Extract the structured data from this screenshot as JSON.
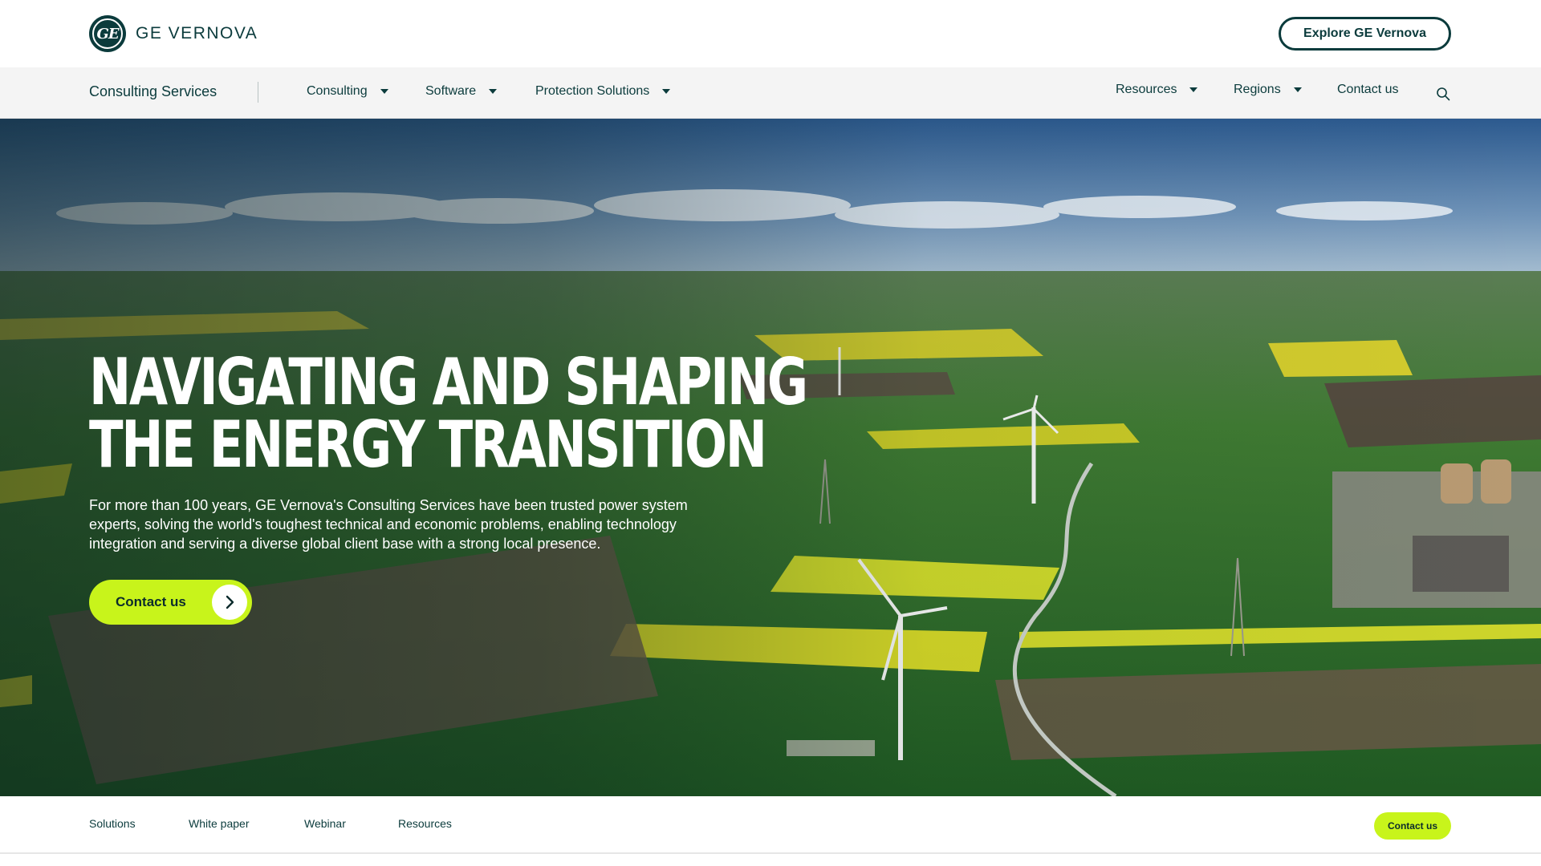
{
  "header": {
    "brand_name": "GE VERNOVA",
    "brand_monogram": "GE",
    "explore_label": "Explore GE Vernova"
  },
  "subnav": {
    "section_title": "Consulting Services",
    "left_items": [
      {
        "label": "Consulting",
        "icon": "chevron-down-icon"
      },
      {
        "label": "Software",
        "icon": "chevron-down-icon"
      },
      {
        "label": "Protection Solutions",
        "icon": "chevron-down-icon"
      }
    ],
    "right_items": [
      {
        "label": "Resources",
        "icon": "chevron-down-icon"
      },
      {
        "label": "Regions",
        "icon": "chevron-down-icon"
      },
      {
        "label": "Contact us"
      }
    ],
    "search_icon": "search-icon"
  },
  "hero": {
    "title_line1": "NAVIGATING AND SHAPING",
    "title_line2": "THE ENERGY TRANSITION",
    "description": "For more than 100 years, GE Vernova's Consulting Services have been trusted power system experts, solving the world's toughest technical and economic problems, enabling technology integration and serving a diverse global client base with a strong local presence.",
    "cta_label": "Contact us",
    "cta_icon": "chevron-right-icon"
  },
  "anchor_bar": {
    "items": [
      "Solutions",
      "White paper",
      "Webinar",
      "Resources"
    ],
    "cta_label": "Contact us"
  },
  "colors": {
    "brand_dark": "#0b3b3c",
    "accent_lime": "#c8f41b",
    "nav_bg": "#f4f4f4"
  }
}
